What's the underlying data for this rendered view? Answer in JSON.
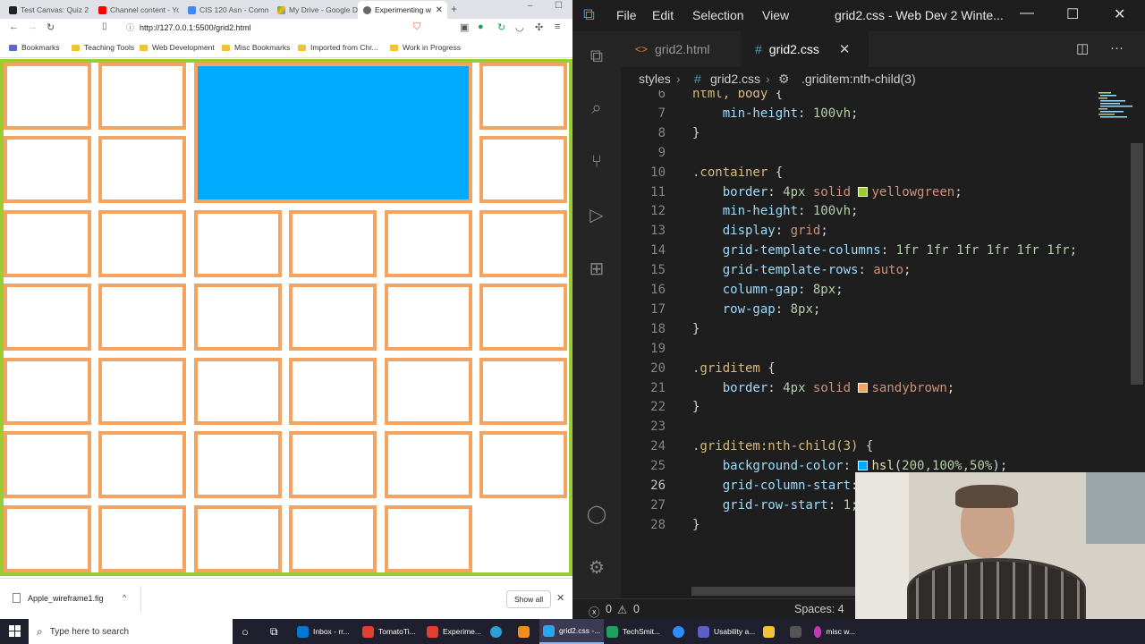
{
  "browser": {
    "tabs": [
      {
        "label": "Test Canvas: Quiz 2",
        "color": "#222222"
      },
      {
        "label": "Channel content - Yo",
        "color": "#ff0000"
      },
      {
        "label": "CIS 120 Asn - Comm",
        "color": "#4285f4"
      },
      {
        "label": "My Drive - Google D",
        "color": "#34a853"
      },
      {
        "label": "Experimenting w",
        "color": "#666666"
      }
    ],
    "new_tab_label": "+",
    "url": "http://127.0.0.1:5500/grid2.html",
    "bookmarks": [
      {
        "label": "Bookmarks"
      },
      {
        "label": "Teaching Tools"
      },
      {
        "label": "Web Development"
      },
      {
        "label": "Misc Bookmarks"
      },
      {
        "label": "Imported from Chr..."
      },
      {
        "label": "Work in Progress"
      }
    ],
    "download_item": "Apple_wireframe1.fig",
    "show_all_label": "Show all"
  },
  "vscode": {
    "menu": [
      "File",
      "Edit",
      "Selection",
      "View"
    ],
    "window_title": "grid2.css - Web Dev 2 Winte...",
    "tabs": [
      {
        "label": "grid2.html",
        "icon": "<>"
      },
      {
        "label": "grid2.css",
        "icon": "#"
      }
    ],
    "breadcrumbs": [
      "styles",
      "grid2.css",
      ".griditem:nth-child(3)"
    ],
    "lines": [
      {
        "n": "6",
        "text": "html, body {"
      },
      {
        "n": "7",
        "text": "    min-height: 100vh;"
      },
      {
        "n": "8",
        "text": "}"
      },
      {
        "n": "9",
        "text": ""
      },
      {
        "n": "10",
        "text": ".container {"
      },
      {
        "n": "11",
        "text": "    border: 4px solid yellowgreen;"
      },
      {
        "n": "12",
        "text": "    min-height: 100vh;"
      },
      {
        "n": "13",
        "text": "    display: grid;"
      },
      {
        "n": "14",
        "text": "    grid-template-columns: 1fr 1fr 1fr 1fr 1fr 1fr;"
      },
      {
        "n": "15",
        "text": "    grid-template-rows: auto;"
      },
      {
        "n": "16",
        "text": "    column-gap: 8px;"
      },
      {
        "n": "17",
        "text": "    row-gap: 8px;"
      },
      {
        "n": "18",
        "text": "}"
      },
      {
        "n": "19",
        "text": ""
      },
      {
        "n": "20",
        "text": ".griditem {"
      },
      {
        "n": "21",
        "text": "    border: 4px solid sandybrown;"
      },
      {
        "n": "22",
        "text": "}"
      },
      {
        "n": "23",
        "text": ""
      },
      {
        "n": "24",
        "text": ".griditem:nth-child(3) {"
      },
      {
        "n": "25",
        "text": "    background-color: hsl(200,100%,50%);"
      },
      {
        "n": "26",
        "text": "    grid-column-start: 3;"
      },
      {
        "n": "27",
        "text": "    grid-row-start: 1;"
      },
      {
        "n": "28",
        "text": "}"
      }
    ],
    "status": {
      "errors": "0",
      "warnings": "0",
      "spaces": "Spaces: 4"
    },
    "colors": {
      "yellowgreen": "#9acd32",
      "sandybrown": "#f4a460",
      "hsl": "#00aaff"
    }
  },
  "taskbar": {
    "search_placeholder": "Type here to search",
    "apps": [
      {
        "label": "Inbox - rr...",
        "color": "#0078d4"
      },
      {
        "label": "TomatoTi...",
        "color": "#e0402f"
      },
      {
        "label": "Experime...",
        "color": "#e0402f"
      },
      {
        "label": "grid2.css -...",
        "color": "#23a9f2"
      },
      {
        "label": "TechSmit...",
        "color": "#20a060"
      },
      {
        "label": "Usability a...",
        "color": "#5b5fc7"
      },
      {
        "label": "misc w...",
        "color": "#c239b3"
      }
    ]
  }
}
